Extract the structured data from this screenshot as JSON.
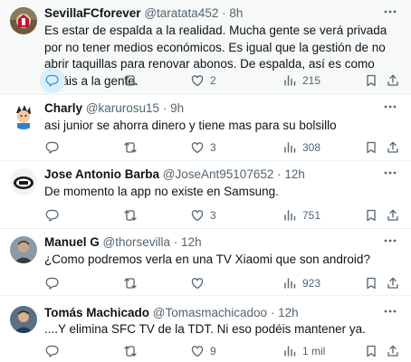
{
  "colors": {
    "text": "#0f1419",
    "muted": "#536471",
    "divider": "#eff3f4",
    "highlight_bg": "#f7f9f9",
    "reply_highlight": "#1d9bf0"
  },
  "tweets": [
    {
      "name": "SevillaFCforever",
      "handle": "@taratata452",
      "sep": "·",
      "time": "8h",
      "text": "Es estar de espalda a la realidad. Mucha gente se verá privada por no tener medios económicos. Es igual que la gestión de no abrir taquillas para renovar abonos. De espalda, así es como tratáis a la gente.",
      "replies": "",
      "retweets": "",
      "likes": "2",
      "views": "215",
      "avatar_icon": "avatar-photo-icon"
    },
    {
      "name": "Charly",
      "handle": "@karurosu15",
      "sep": "·",
      "time": "9h",
      "text": "asi junior se ahorra dinero y tiene mas para su bolsillo",
      "replies": "",
      "retweets": "",
      "likes": "3",
      "views": "308",
      "avatar_icon": "cartoon-avatar-icon"
    },
    {
      "name": "Jose Antonio Barba",
      "handle": "@JoseAnt95107652",
      "sep": "·",
      "time": "12h",
      "text": "De momento la app no existe en Samsung.",
      "replies": "",
      "retweets": "",
      "likes": "3",
      "views": "751",
      "avatar_icon": "logo-avatar-icon"
    },
    {
      "name": "Manuel G",
      "handle": "@thorsevilla",
      "sep": "·",
      "time": "12h",
      "text": "¿Como podremos verla en una TV Xiaomi que son android?",
      "replies": "",
      "retweets": "",
      "likes": "",
      "views": "923",
      "avatar_icon": "person-avatar-icon"
    },
    {
      "name": "Tomás Machicado",
      "handle": "@Tomasmachicadoo",
      "sep": "·",
      "time": "12h",
      "text": "....Y elimina SFC TV de la TDT.  Ni eso podéis mantener ya.",
      "replies": "",
      "retweets": "",
      "likes": "9",
      "views": "1 mil",
      "avatar_icon": "person-avatar-icon"
    }
  ]
}
